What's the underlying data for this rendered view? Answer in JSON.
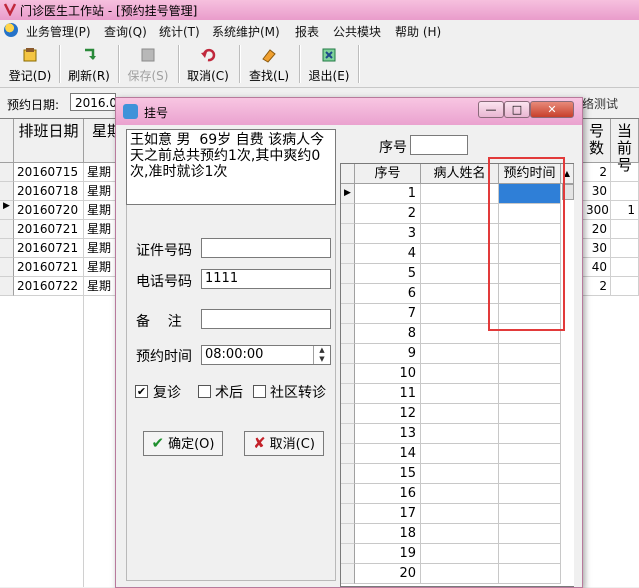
{
  "window": {
    "title": "门诊医生工作站 - [预约挂号管理]"
  },
  "menu": [
    "业务管理(P)",
    "查询(Q)",
    "统计(T)",
    "系统维护(M)",
    "报表",
    "公共模块",
    "帮助 (H)"
  ],
  "toolbar": [
    {
      "label": "登记(D)",
      "icon": "register-icon",
      "enabled": true
    },
    {
      "label": "刷新(R)",
      "icon": "refresh-icon",
      "enabled": true
    },
    {
      "label": "保存(S)",
      "icon": "save-icon",
      "enabled": false
    },
    {
      "label": "取消(C)",
      "icon": "undo-icon",
      "enabled": true
    },
    {
      "label": "查找(L)",
      "icon": "find-icon",
      "enabled": true
    },
    {
      "label": "退出(E)",
      "icon": "exit-icon",
      "enabled": true
    }
  ],
  "filter": {
    "date_label": "预约日期:",
    "date_value": "2016.0",
    "right_tag": "络测试"
  },
  "bg_grid": {
    "headers": [
      "排班日期",
      "星期",
      "号数",
      "当前号"
    ],
    "rows": [
      {
        "date": "20160715",
        "week": "星期",
        "count": "2",
        "current": ""
      },
      {
        "date": "20160718",
        "week": "星期",
        "count": "30",
        "current": ""
      },
      {
        "date": "20160720",
        "week": "星期",
        "count": "300",
        "current": "1"
      },
      {
        "date": "20160721",
        "week": "星期",
        "count": "20",
        "current": ""
      },
      {
        "date": "20160721",
        "week": "星期",
        "count": "30",
        "current": ""
      },
      {
        "date": "20160721",
        "week": "星期",
        "count": "40",
        "current": ""
      },
      {
        "date": "20160722",
        "week": "星期",
        "count": "2",
        "current": ""
      }
    ],
    "current_row_index": 2
  },
  "dialog": {
    "title": "挂号",
    "info_text": "王如意 男  69岁 自费 该病人今天之前总共预约1次,其中爽约0次,准时就诊1次",
    "fields": {
      "id_label": "证件号码",
      "id_value": "",
      "phone_label": "电话号码",
      "phone_value": "1111",
      "note_label": "备    注",
      "note_value": "",
      "time_label": "预约时间",
      "time_value": "08:00:00"
    },
    "checkboxes": [
      {
        "label": "复诊",
        "checked": true
      },
      {
        "label": "术后",
        "checked": false
      },
      {
        "label": "社区转诊",
        "checked": false
      }
    ],
    "confirm_label": "确定(O)",
    "cancel_label": "取消(C)",
    "seq_label": "序号",
    "seq_value": "",
    "grid": {
      "headers": [
        "序号",
        "病人姓名",
        "预约时间"
      ],
      "rows": [
        1,
        2,
        3,
        4,
        5,
        6,
        7,
        8,
        9,
        10,
        11,
        12,
        13,
        14,
        15,
        16,
        17,
        18,
        19,
        20
      ],
      "selected_row_index": 0
    }
  }
}
